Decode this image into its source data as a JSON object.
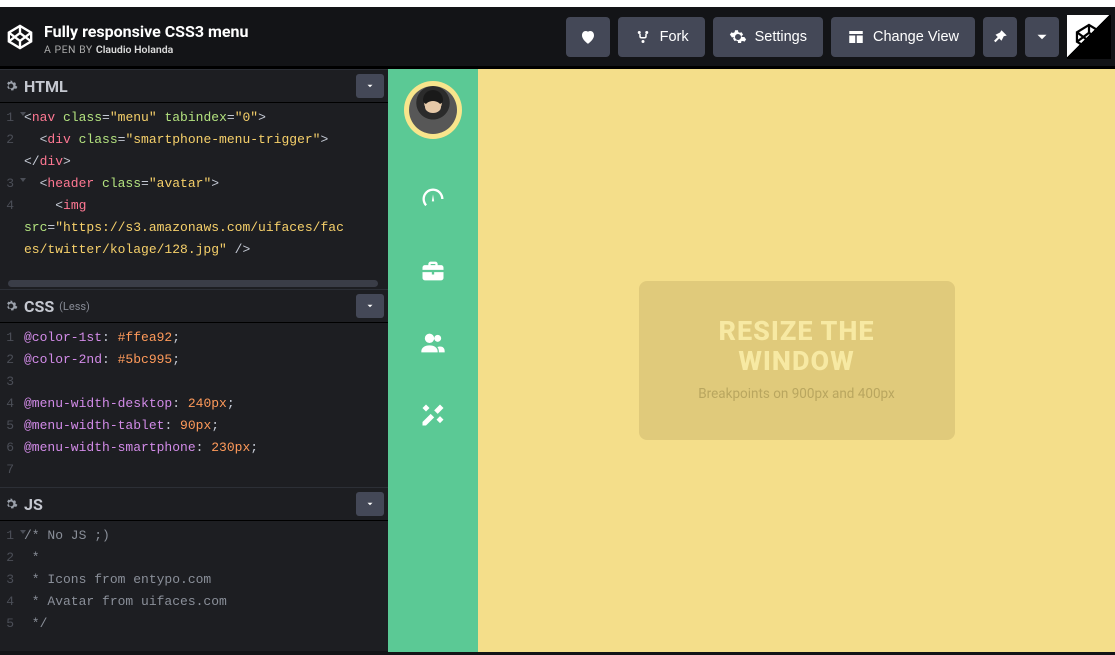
{
  "header": {
    "title": "Fully responsive CSS3 menu",
    "byline_prefix": "A PEN BY",
    "author": "Claudio Holanda",
    "buttons": {
      "fork": "Fork",
      "settings": "Settings",
      "change_view": "Change View"
    }
  },
  "panels": {
    "html": {
      "title": "HTML"
    },
    "css": {
      "title": "CSS",
      "sub": "(Less)"
    },
    "js": {
      "title": "JS"
    }
  },
  "html_code": {
    "l1a": "<",
    "l1a2": "nav",
    "l1b": " class",
    "l1c": "=",
    "l1d": "\"menu\"",
    "l1e": " tabindex",
    "l1f": "=",
    "l1g": "\"0\"",
    "l1h": ">",
    "l2a": "  <",
    "l2a2": "div",
    "l2b": " class",
    "l2c": "=",
    "l2d": "\"smartphone-menu-trigger\"",
    "l2e": ">",
    "lend": "</",
    "lend2": "div",
    "lend3": ">",
    "l3a": "  <",
    "l3a2": "header",
    "l3b": " class",
    "l3c": "=",
    "l3d": "\"avatar\"",
    "l3e": ">",
    "l4a": "    <",
    "l4a2": "img",
    "l5a": "src",
    "l5b": "=",
    "l5c": "\"https://s3.amazonaws.com/uifaces/fac",
    "l6a": "es/twitter/kolage/128.jpg\"",
    "l6b": " />"
  },
  "css_code": {
    "l1a": "@color-1st",
    "l1b": ": ",
    "l1c": "#ffea92",
    "l1d": ";",
    "l2a": "@color-2nd",
    "l2b": ": ",
    "l2c": "#5bc995",
    "l2d": ";",
    "l4a": "@menu-width-desktop",
    "l4b": ": ",
    "l4c": "240px",
    "l4d": ";",
    "l5a": "@menu-width-tablet",
    "l5b": ": ",
    "l5c": "90px",
    "l5d": ";",
    "l6a": "@menu-width-smartphone",
    "l6b": ": ",
    "l6c": "230px",
    "l6d": ";"
  },
  "js_code": {
    "l1": "/* No JS ;)",
    "l2": " *",
    "l3": " * Icons from entypo.com",
    "l4": " * Avatar from uifaces.com",
    "l5": " */"
  },
  "preview": {
    "card_title": "RESIZE THE WINDOW",
    "card_sub": "Breakpoints on 900px and 400px",
    "menu_icons": [
      "gauge-icon",
      "briefcase-icon",
      "users-icon",
      "tools-icon"
    ]
  }
}
